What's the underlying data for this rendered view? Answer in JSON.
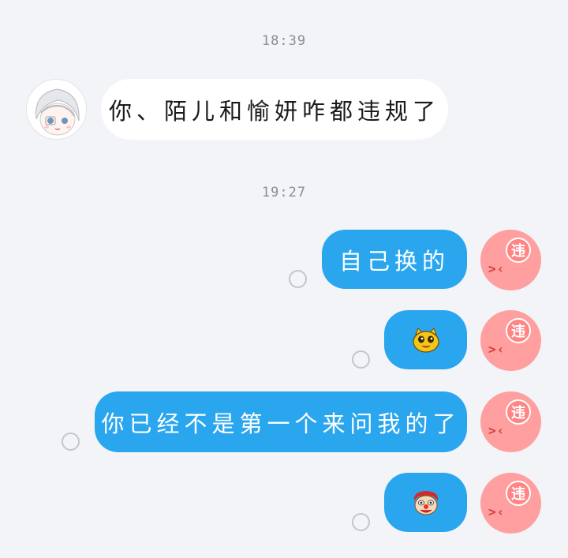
{
  "messages": {
    "timestamp_1": "18:39",
    "received_text": "你、陌儿和愉妍咋都违规了",
    "timestamp_2": "19:27",
    "sent_1": "自己换的",
    "sent_3": "你已经不是第一个来问我的了"
  },
  "self_avatar": {
    "badge": "违",
    "eyes": ">‹"
  },
  "sticker_1": {
    "icon": "yellow-cat-sticker-icon"
  },
  "sticker_2": {
    "icon": "clown-face-sticker-icon"
  },
  "colors": {
    "outgoing_bubble": "#2aa6ef",
    "incoming_bubble": "#ffffff",
    "background": "#f3f4f8",
    "avatar": "#ff9f9f"
  }
}
